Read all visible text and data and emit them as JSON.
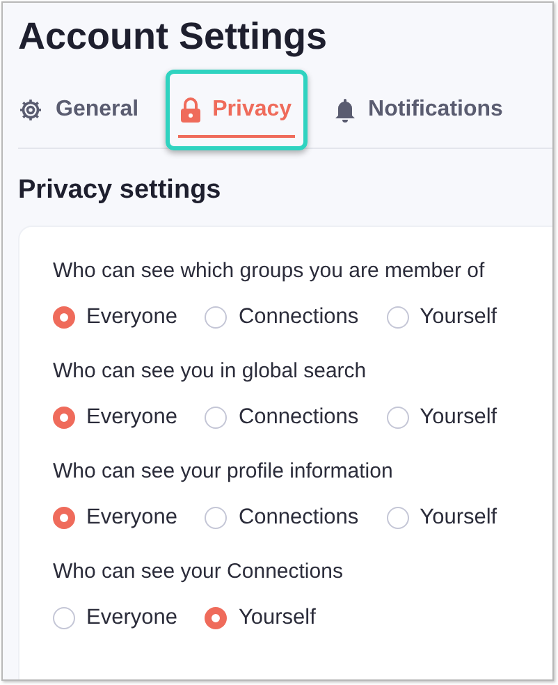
{
  "title": "Account Settings",
  "tabs": [
    {
      "label": "General",
      "kind": "gear",
      "selected": false,
      "highlighted": false
    },
    {
      "label": "Privacy",
      "kind": "lock",
      "selected": true,
      "highlighted": true
    },
    {
      "label": "Notifications",
      "kind": "bell",
      "selected": false,
      "highlighted": false
    }
  ],
  "section_title": "Privacy settings",
  "questions": [
    {
      "label": "Who can see which groups you are member of",
      "options": [
        {
          "label": "Everyone",
          "selected": true
        },
        {
          "label": "Connections",
          "selected": false
        },
        {
          "label": "Yourself",
          "selected": false
        }
      ]
    },
    {
      "label": "Who can see you in global search",
      "options": [
        {
          "label": "Everyone",
          "selected": true
        },
        {
          "label": "Connections",
          "selected": false
        },
        {
          "label": "Yourself",
          "selected": false
        }
      ]
    },
    {
      "label": "Who can see your profile information",
      "options": [
        {
          "label": "Everyone",
          "selected": true
        },
        {
          "label": "Connections",
          "selected": false
        },
        {
          "label": "Yourself",
          "selected": false
        }
      ]
    },
    {
      "label": "Who can see your Connections",
      "options": [
        {
          "label": "Everyone",
          "selected": false
        },
        {
          "label": "Yourself",
          "selected": true
        }
      ]
    }
  ]
}
